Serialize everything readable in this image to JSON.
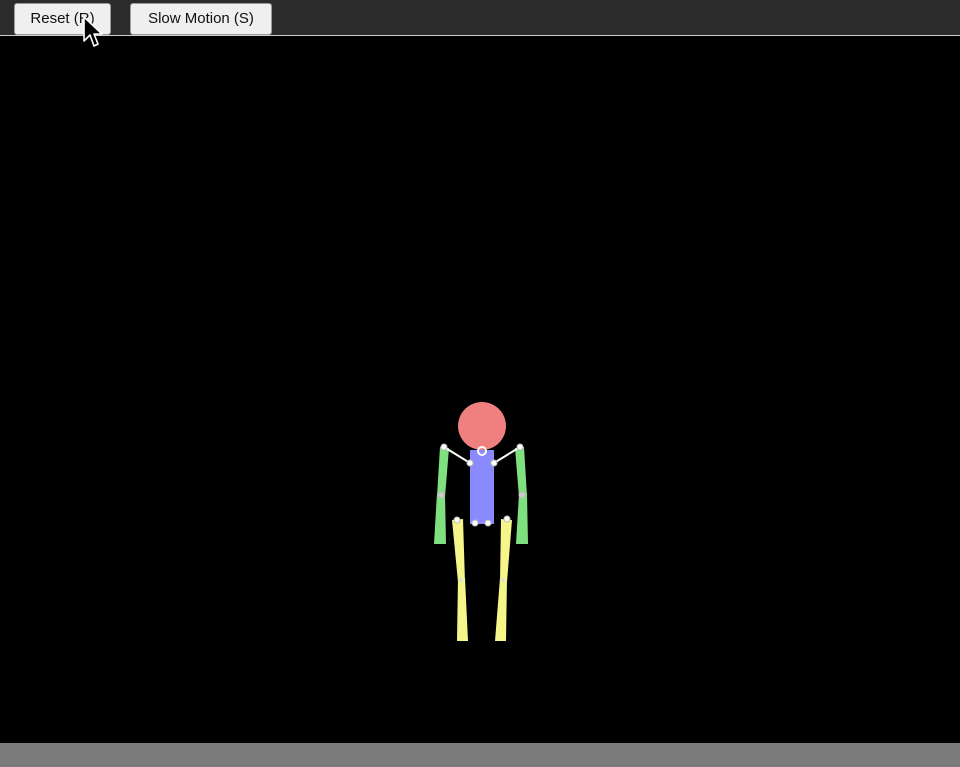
{
  "toolbar": {
    "reset_label": "Reset (R)",
    "slow_motion_label": "Slow Motion (S)"
  },
  "scene": {
    "background_color": "#000000",
    "ground_color": "#7b7b7b",
    "colors": {
      "head": "#f08080",
      "torso": "#8a8aff",
      "arms": "#7fe07f",
      "legs": "#f5f58a",
      "joints": "#ffffff"
    }
  },
  "cursor": {
    "icon": "mouse-pointer-icon"
  }
}
